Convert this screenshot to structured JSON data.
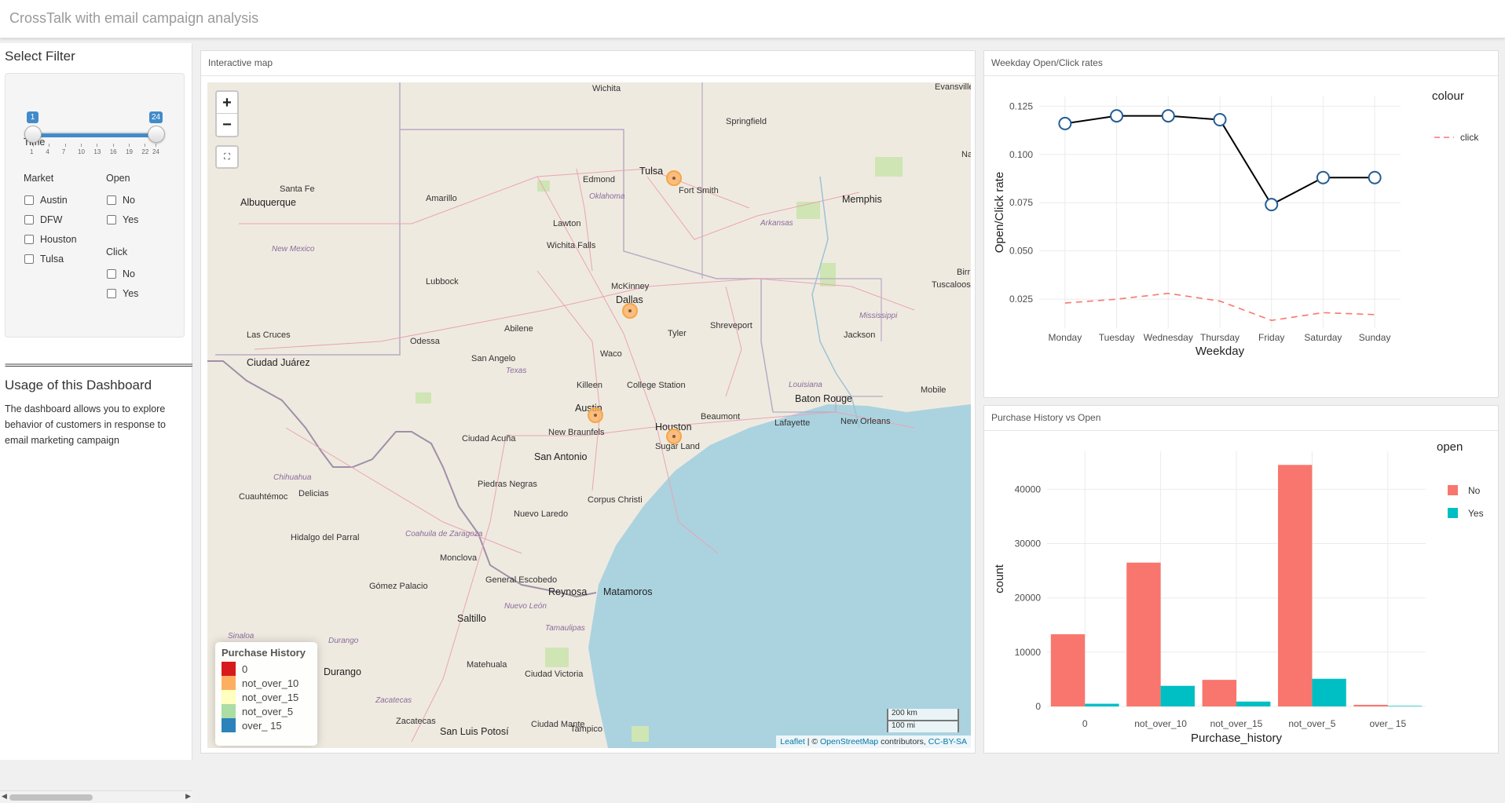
{
  "app": {
    "title": "CrossTalk with email campaign analysis"
  },
  "sidebar": {
    "heading": "Select Filter",
    "time": {
      "label": "Time",
      "min": 1,
      "max": 24,
      "low": 1,
      "high": 24,
      "ticks": [
        "1",
        "4",
        "7",
        "10",
        "13",
        "16",
        "19",
        "22",
        "24"
      ]
    },
    "market": {
      "label": "Market",
      "options": [
        "Austin",
        "DFW",
        "Houston",
        "Tulsa"
      ]
    },
    "open": {
      "label": "Open",
      "options": [
        "No",
        "Yes"
      ]
    },
    "click": {
      "label": "Click",
      "options": [
        "No",
        "Yes"
      ]
    },
    "separator": "================================================",
    "usage_title": "Usage of this Dashboard",
    "usage_text": "The dashboard allows you to explore behavior of customers in response to email marketing campaign"
  },
  "map_card": {
    "title": "Interactive map",
    "zoom_in": "+",
    "zoom_out": "−",
    "fullscreen_icon": "fullscreen-icon",
    "legend": {
      "title": "Purchase History",
      "items": [
        {
          "label": "0",
          "color": "#d7191c"
        },
        {
          "label": "not_over_10",
          "color": "#fdae61"
        },
        {
          "label": "not_over_15",
          "color": "#ffffbf"
        },
        {
          "label": "not_over_5",
          "color": "#abdda4"
        },
        {
          "label": "over_ 15",
          "color": "#2b83ba"
        }
      ]
    },
    "scale": {
      "km": "200 km",
      "mi": "100 mi"
    },
    "attribution": {
      "leaflet": "Leaflet",
      "sep": " | © ",
      "osm": "OpenStreetMap",
      "contrib": " contributors, ",
      "license": "CC-BY-SA"
    },
    "place_labels": [
      "Wichita",
      "Evansville",
      "Springfield",
      "Tulsa",
      "Edmond",
      "Fort Smith",
      "Oklahoma",
      "Santa Fe",
      "Albuquerque",
      "Amarillo",
      "Memphis",
      "Arkansas",
      "New Mexico",
      "Lawton",
      "Wichita Falls",
      "Lubbock",
      "McKinney",
      "Dallas",
      "Birr",
      "Tuscaloosa",
      "Mississippi",
      "Las Cruces",
      "Odessa",
      "Abilene",
      "Tyler",
      "Shreveport",
      "Jackson",
      "Ciudad Juárez",
      "San Angelo",
      "Waco",
      "Texas",
      "Killeen",
      "College Station",
      "Louisiana",
      "Baton Rouge",
      "Mobile",
      "Austin",
      "New Braunfels",
      "Houston",
      "Beaumont",
      "Lafayette",
      "New Orleans",
      "Ciudad Acuña",
      "San Antonio",
      "Sugar Land",
      "Chihuahua",
      "Cuauhtémoc",
      "Delicias",
      "Piedras Negras",
      "Corpus Christi",
      "Nuevo Laredo",
      "Hidalgo del Parral",
      "Coahuila de Zaragoza",
      "Monclova",
      "General Escobedo",
      "Gómez Palacio",
      "Reynosa",
      "Matamoros",
      "Nuevo León",
      "Saltillo",
      "Sinaloa",
      "Durango",
      "Tamaulipas",
      "Matehuala",
      "Ciudad Victoria",
      "Zacatecas",
      "San Luis Potosí",
      "Ciudad Mante",
      "Tampico",
      "Na"
    ]
  },
  "weekday_card": {
    "title": "Weekday Open/Click rates",
    "chart_data": {
      "type": "line",
      "categories": [
        "Monday",
        "Tuesday",
        "Wednesday",
        "Thursday",
        "Friday",
        "Saturday",
        "Sunday"
      ],
      "series": [
        {
          "values": [
            0.116,
            0.12,
            0.12,
            0.118,
            0.074,
            0.088,
            0.088
          ],
          "style": "solid-with-circles",
          "color": "#000000"
        },
        {
          "name": "click",
          "values": [
            0.023,
            0.025,
            0.028,
            0.024,
            0.014,
            0.018,
            0.017
          ],
          "style": "dashed",
          "color": "#f8766d"
        }
      ],
      "xlabel": "Weekday",
      "ylabel": "Open/Click rate",
      "ylim": [
        0.01,
        0.13
      ],
      "yticks": [
        "0.025",
        "0.050",
        "0.075",
        "0.100",
        "0.125"
      ],
      "legend_title": "colour",
      "legend": [
        "click"
      ],
      "grid": true
    }
  },
  "purchase_card": {
    "title": "Purchase History vs Open",
    "chart_data": {
      "type": "bar",
      "categories": [
        "0",
        "not_over_10",
        "not_over_15",
        "not_over_5",
        "over_ 15"
      ],
      "series": [
        {
          "name": "No",
          "values": [
            13300,
            26500,
            4900,
            44500,
            300
          ],
          "color": "#f8766d"
        },
        {
          "name": "Yes",
          "values": [
            500,
            3800,
            900,
            5100,
            100
          ],
          "color": "#00bfc4"
        }
      ],
      "xlabel": "Purchase_history",
      "ylabel": "count",
      "ylim": [
        0,
        47000
      ],
      "yticks": [
        "0",
        "10000",
        "20000",
        "30000",
        "40000"
      ],
      "legend_title": "open",
      "grid": true
    }
  }
}
